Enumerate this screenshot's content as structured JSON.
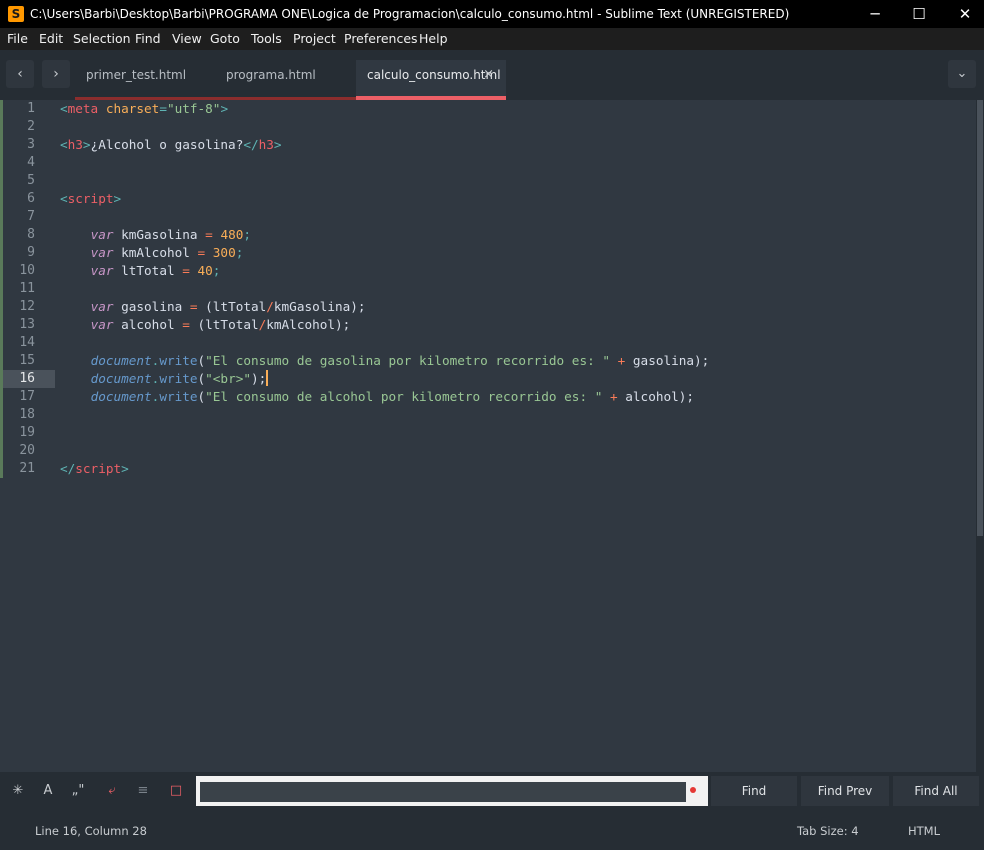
{
  "window": {
    "title": "C:\\Users\\Barbi\\Desktop\\Barbi\\PROGRAMA ONE\\Logica de Programacion\\calculo_consumo.html - Sublime Text (UNREGISTERED)",
    "app_icon": "S",
    "minimize": "─",
    "maximize": "☐",
    "close": "✕"
  },
  "menu": [
    "File",
    "Edit",
    "Selection",
    "Find",
    "View",
    "Goto",
    "Tools",
    "Project",
    "Preferences",
    "Help"
  ],
  "nav": {
    "back": "‹",
    "forward": "›",
    "dropdown": "⌄"
  },
  "tabs": [
    {
      "label": "primer_test.html",
      "active": false
    },
    {
      "label": "programa.html",
      "active": false
    },
    {
      "label": "calculo_consumo.html",
      "active": true,
      "close": "×"
    }
  ],
  "accent_colors": {
    "tab_underline": "#ec5f66",
    "inactive_underline": "#8b2d2d",
    "cursor": "#f9ae58"
  },
  "editor": {
    "current_line": 16,
    "lines": [
      [
        [
          "<",
          "punc"
        ],
        [
          "meta",
          "tag"
        ],
        [
          " ",
          ""
        ],
        [
          "charset",
          "attr"
        ],
        [
          "=",
          "punc"
        ],
        [
          "\"utf-8\"",
          "str"
        ],
        [
          ">",
          "punc"
        ]
      ],
      [],
      [
        [
          "<",
          "punc"
        ],
        [
          "h3",
          "tag"
        ],
        [
          ">",
          "punc"
        ],
        [
          "¿Alcohol o gasolina?",
          ""
        ],
        [
          "</",
          "punc"
        ],
        [
          "h3",
          "tag"
        ],
        [
          ">",
          "punc"
        ]
      ],
      [],
      [],
      [
        [
          "<",
          "punc"
        ],
        [
          "script",
          "tag"
        ],
        [
          ">",
          "punc"
        ]
      ],
      [],
      [
        [
          "    ",
          ""
        ],
        [
          "var",
          "kw"
        ],
        [
          " kmGasolina ",
          ""
        ],
        [
          "=",
          "op"
        ],
        [
          " ",
          ""
        ],
        [
          "480",
          "num"
        ],
        [
          ";",
          "punc"
        ]
      ],
      [
        [
          "    ",
          ""
        ],
        [
          "var",
          "kw"
        ],
        [
          " kmAlcohol ",
          ""
        ],
        [
          "=",
          "op"
        ],
        [
          " ",
          ""
        ],
        [
          "300",
          "num"
        ],
        [
          ";",
          "punc"
        ]
      ],
      [
        [
          "    ",
          ""
        ],
        [
          "var",
          "kw"
        ],
        [
          " ltTotal ",
          ""
        ],
        [
          "=",
          "op"
        ],
        [
          " ",
          ""
        ],
        [
          "40",
          "num"
        ],
        [
          ";",
          "punc"
        ]
      ],
      [],
      [
        [
          "    ",
          ""
        ],
        [
          "var",
          "kw"
        ],
        [
          " gasolina ",
          ""
        ],
        [
          "=",
          "op"
        ],
        [
          " (ltTotal",
          ""
        ],
        [
          "/",
          "op"
        ],
        [
          "kmGasolina);",
          ""
        ]
      ],
      [
        [
          "    ",
          ""
        ],
        [
          "var",
          "kw"
        ],
        [
          " alcohol ",
          ""
        ],
        [
          "=",
          "op"
        ],
        [
          " (ltTotal",
          ""
        ],
        [
          "/",
          "op"
        ],
        [
          "kmAlcohol);",
          ""
        ]
      ],
      [],
      [
        [
          "    ",
          ""
        ],
        [
          "document",
          "obj"
        ],
        [
          ".",
          "punc"
        ],
        [
          "write",
          "fn"
        ],
        [
          "(",
          ""
        ],
        [
          "\"El consumo de gasolina por kilometro recorrido es: \"",
          "str"
        ],
        [
          " ",
          ""
        ],
        [
          "+",
          "op"
        ],
        [
          " gasolina);",
          ""
        ]
      ],
      [
        [
          "    ",
          ""
        ],
        [
          "document",
          "obj"
        ],
        [
          ".",
          "punc"
        ],
        [
          "write",
          "fn"
        ],
        [
          "(",
          ""
        ],
        [
          "\"<br>\"",
          "str"
        ],
        [
          ");",
          ""
        ],
        [
          "",
          "cursor"
        ]
      ],
      [
        [
          "    ",
          ""
        ],
        [
          "document",
          "obj"
        ],
        [
          ".",
          "punc"
        ],
        [
          "write",
          "fn"
        ],
        [
          "(",
          ""
        ],
        [
          "\"El consumo de alcohol por kilometro recorrido es: \"",
          "str"
        ],
        [
          " ",
          ""
        ],
        [
          "+",
          "op"
        ],
        [
          " alcohol);",
          ""
        ]
      ],
      [],
      [],
      [],
      [
        [
          "</",
          "punc"
        ],
        [
          "script",
          "tag"
        ],
        [
          ">",
          "punc"
        ]
      ]
    ]
  },
  "findbar": {
    "options": [
      {
        "name": "regex-icon",
        "glyph": "✳"
      },
      {
        "name": "case-sensitive-icon",
        "glyph": "A"
      },
      {
        "name": "whole-word-icon",
        "glyph": "„\""
      },
      {
        "name": "wrap-icon",
        "glyph": "⤶"
      },
      {
        "name": "in-selection-icon",
        "glyph": "≡"
      },
      {
        "name": "highlight-matches-icon",
        "glyph": "□"
      }
    ],
    "input_value": "",
    "find": "Find",
    "find_prev": "Find Prev",
    "find_all": "Find All"
  },
  "status": {
    "position": "Line 16, Column 28",
    "tab_size": "Tab Size: 4",
    "syntax": "HTML"
  }
}
